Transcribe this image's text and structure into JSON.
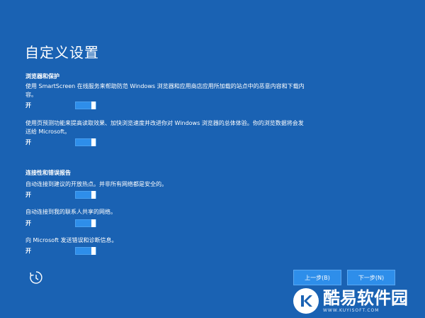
{
  "page": {
    "title": "自定义设置"
  },
  "sections": [
    {
      "heading": "浏览器和保护",
      "items": [
        {
          "description": "使用 SmartScreen 在线服务来帮助防范 Windows 浏览器和应用商店应用所加载的站点中的恶意内容和下载内容。",
          "state": "开",
          "on": true
        },
        {
          "description": "使用页预测功能来提高读取效果、加快浏览速度并改进你对 Windows 浏览器的总体体验。你的浏览数据将会发送给 Microsoft。",
          "state": "开",
          "on": true
        }
      ]
    },
    {
      "heading": "连接性和错误报告",
      "items": [
        {
          "description": "自动连接到建议的开放热点。并非所有网络都是安全的。",
          "state": "开",
          "on": true
        },
        {
          "description": "自动连接到我的联系人共享的网络。",
          "state": "开",
          "on": true
        },
        {
          "description": "向 Microsoft 发送错误和诊断信息。",
          "state": "开",
          "on": true
        }
      ]
    }
  ],
  "footer": {
    "ease_of_access_icon": "ease-of-access-icon",
    "back_label": "上一步(B)",
    "next_label": "下一步(N)"
  },
  "watermark": {
    "logo_letter": "K",
    "brand": "酷易软件园",
    "url": "WWW.KUYISOFT.COM"
  },
  "colors": {
    "background": "#1a62b3",
    "toggle_on": "#2e8eea",
    "text": "#ffffff"
  }
}
